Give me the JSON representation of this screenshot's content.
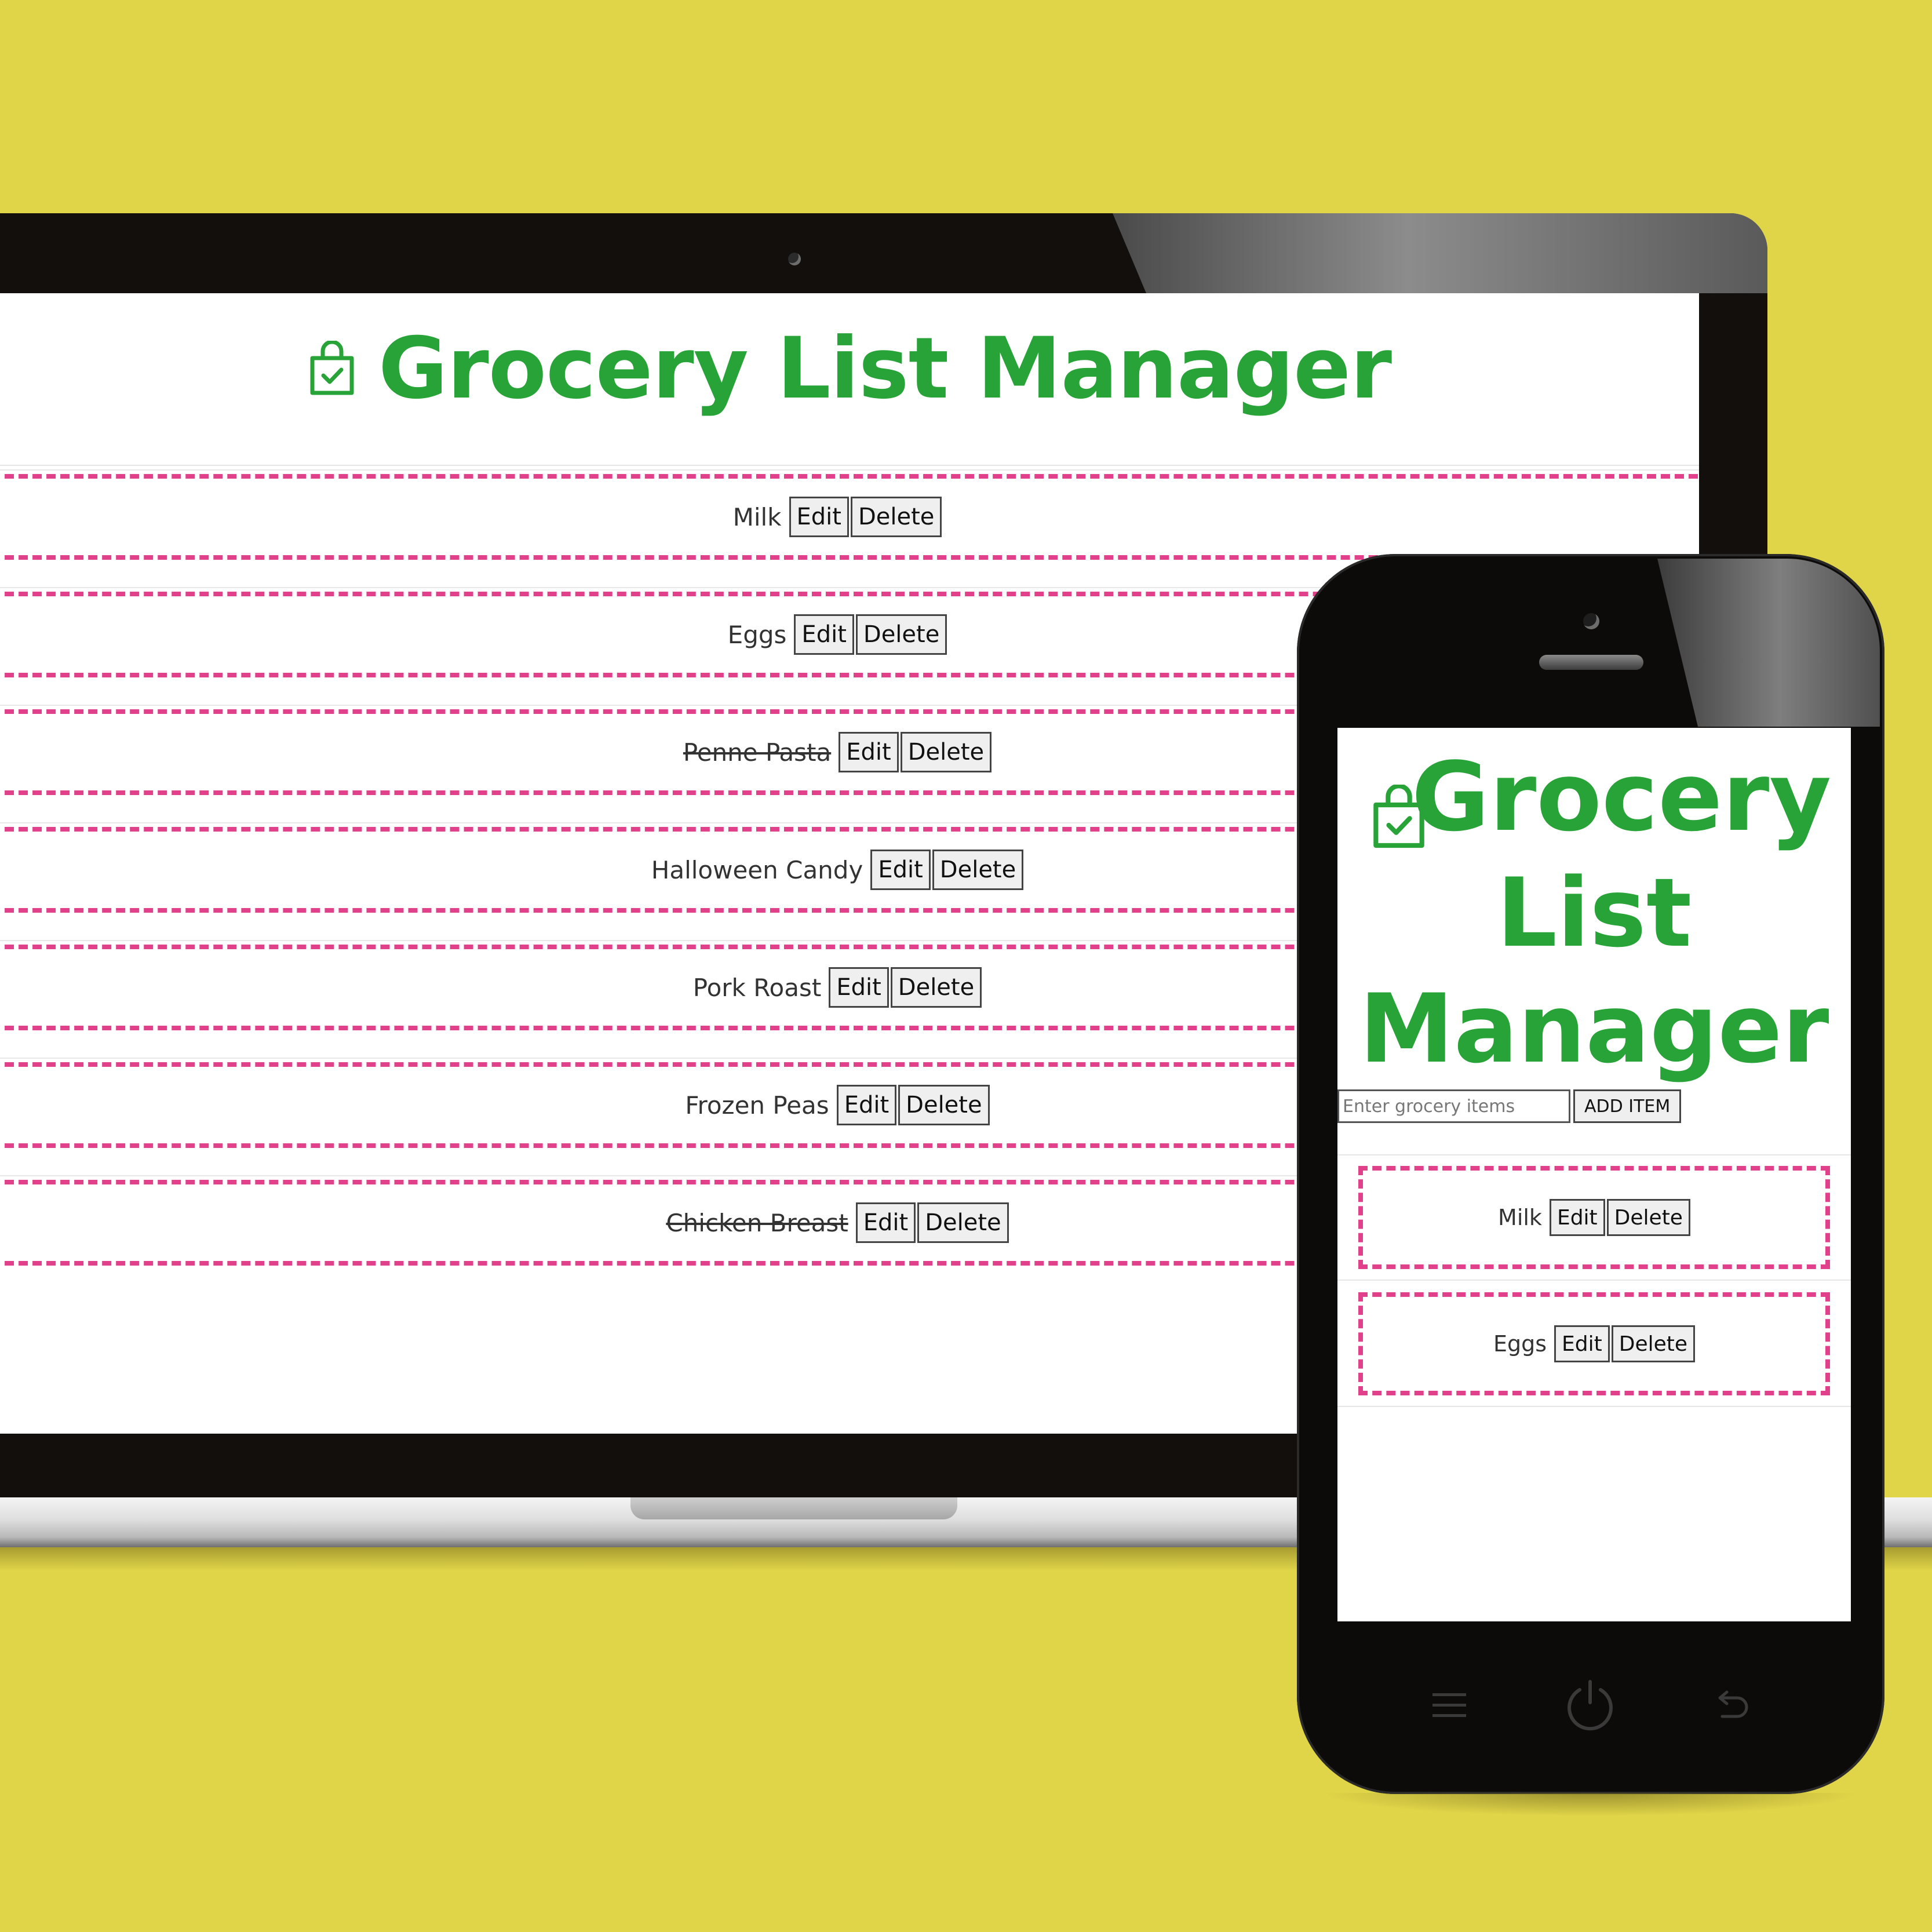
{
  "app": {
    "title": "Grocery List Manager",
    "title_lines": [
      "Grocery",
      "List",
      "Manager"
    ],
    "icon": "shopping-bag-check-icon",
    "accent_color": "#27a337",
    "dash_color": "#e0418a",
    "background_color": "#e0d448"
  },
  "desktop": {
    "items": [
      {
        "name": "Milk",
        "completed": false
      },
      {
        "name": "Eggs",
        "completed": false
      },
      {
        "name": "Penne Pasta",
        "completed": true
      },
      {
        "name": "Halloween Candy",
        "completed": false
      },
      {
        "name": "Pork Roast",
        "completed": false
      },
      {
        "name": "Frozen Peas",
        "completed": false
      },
      {
        "name": "Chicken Breast",
        "completed": true
      }
    ],
    "edit_label": "Edit",
    "delete_label": "Delete"
  },
  "mobile": {
    "input": {
      "placeholder": "Enter grocery items",
      "value": ""
    },
    "add_label": "ADD ITEM",
    "items": [
      {
        "name": "Milk",
        "completed": false
      },
      {
        "name": "Eggs",
        "completed": false
      }
    ],
    "edit_label": "Edit",
    "delete_label": "Delete",
    "nav_icons": [
      "menu-icon",
      "power-icon",
      "back-icon"
    ]
  }
}
